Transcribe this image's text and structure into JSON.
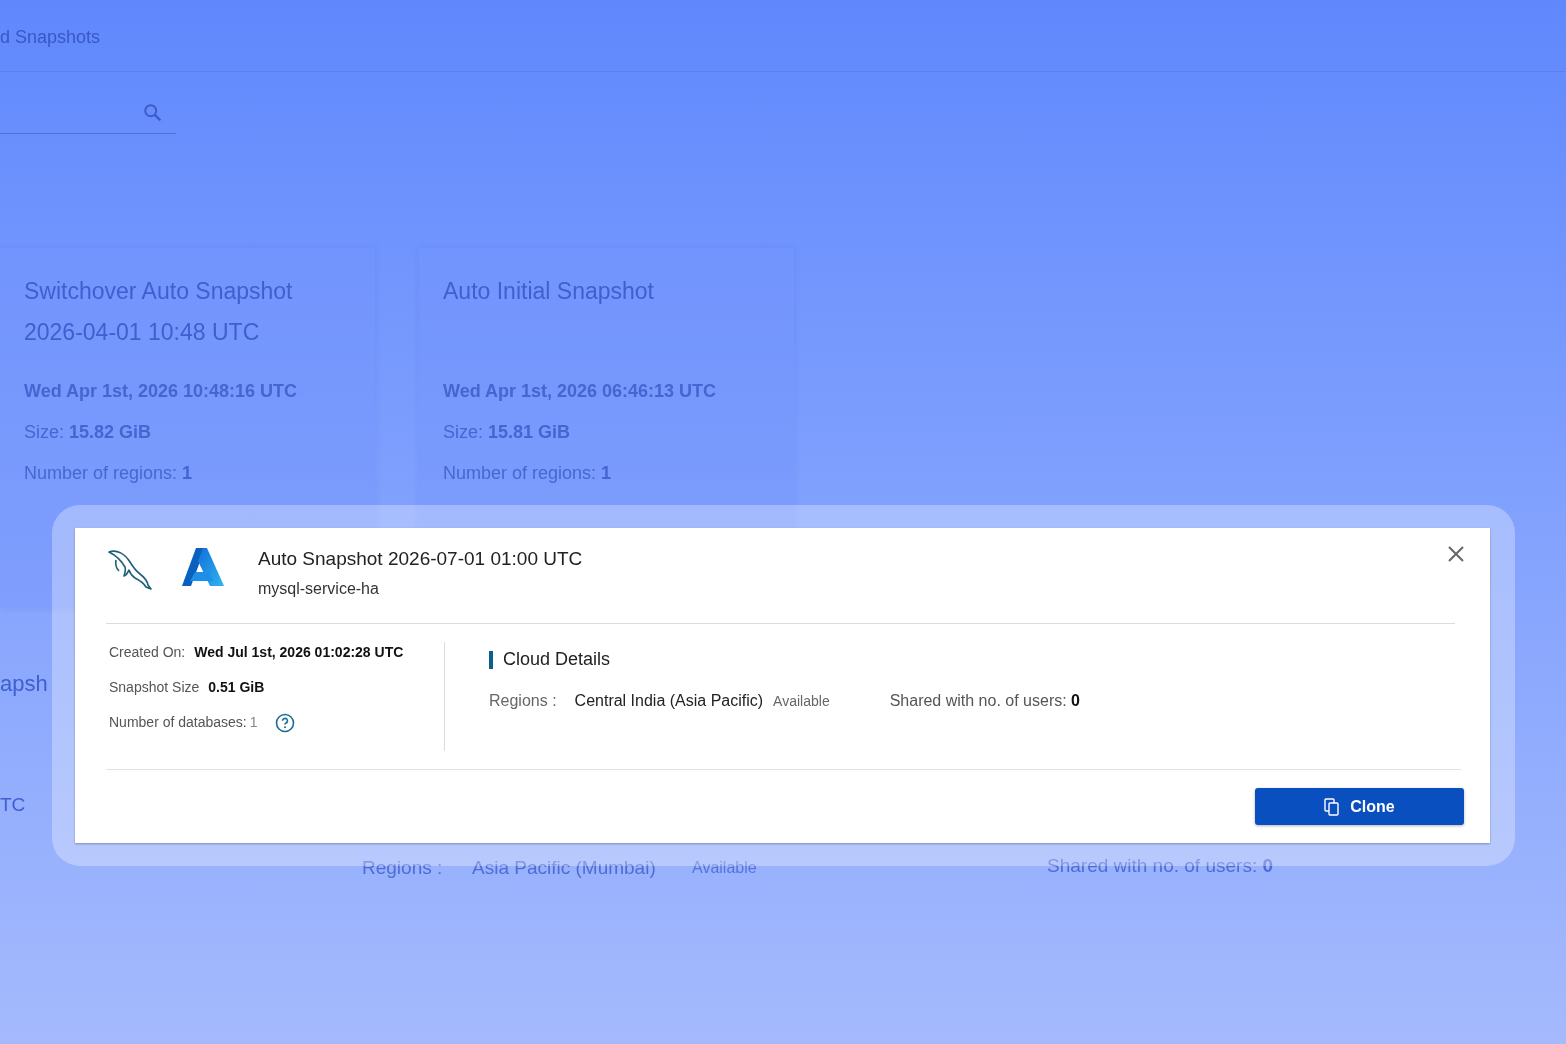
{
  "background": {
    "breadcrumb": "d Snapshots",
    "cards": [
      {
        "title": "Switchover Auto Snapshot",
        "subtitle": "2026-04-01 10:48 UTC",
        "date": "Wed Apr 1st, 2026 10:48:16 UTC",
        "size_label": "Size:",
        "size": "15.82 GiB",
        "regions_label": "Number of regions:",
        "regions": "1"
      },
      {
        "title": "Auto Initial Snapshot",
        "date": "Wed Apr 1st, 2026 06:46:13 UTC",
        "size_label": "Size:",
        "size": "15.81 GiB",
        "regions_label": "Number of regions:",
        "regions": "1"
      }
    ],
    "row_fragment": "apsh",
    "time_fragment": "TC",
    "regions_label": "Regions :",
    "region": "Asia Pacific (Mumbai)",
    "region_status": "Available",
    "shared_label": "Shared with no. of users:",
    "shared_value": "0"
  },
  "dialog": {
    "title": "Auto Snapshot 2026-07-01 01:00 UTC",
    "subtitle": "mysql-service-ha",
    "details": [
      {
        "label": "Created On:",
        "value": "Wed Jul 1st, 2026 01:02:28 UTC",
        "kind": "strong"
      },
      {
        "label": "Snapshot Size",
        "value": "0.51 GiB",
        "kind": "strong"
      },
      {
        "label": "Number of databases:",
        "value": "1",
        "kind": "help"
      }
    ],
    "cloud_heading": "Cloud Details",
    "regions_label": "Regions :",
    "region": "Central India (Asia Pacific)",
    "region_status": "Available",
    "shared_label": "Shared with no. of users:",
    "shared_value": "0",
    "button": "Clone"
  }
}
